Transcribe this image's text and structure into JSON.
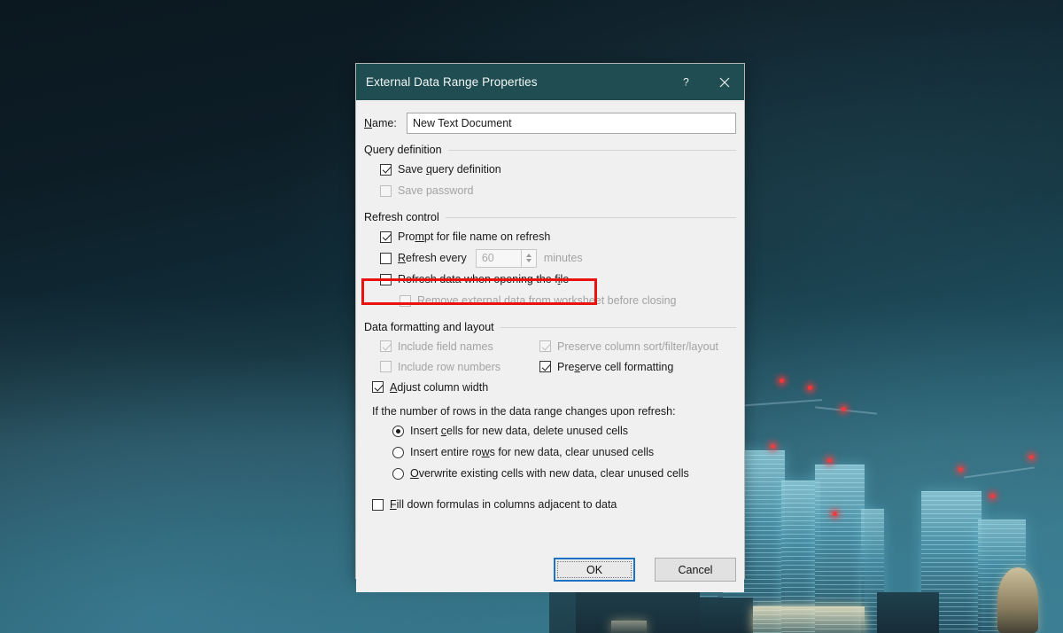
{
  "desktop": {
    "wallpaper_name": "london-night-skyline"
  },
  "dialog": {
    "title": "External Data Range Properties",
    "help_icon": "question-mark-icon",
    "close_icon": "close-icon",
    "name_label": "Name:",
    "name_value": "New Text Document",
    "groups": [
      {
        "id": "query-definition",
        "header": "Query definition",
        "items": [
          {
            "id": "save-query-definition",
            "type": "checkbox",
            "label": "Save query definition",
            "checked": true,
            "disabled": false,
            "indent": 1
          },
          {
            "id": "save-password",
            "type": "checkbox",
            "label": "Save password",
            "checked": false,
            "disabled": true,
            "indent": 1
          }
        ]
      },
      {
        "id": "refresh-control",
        "header": "Refresh control",
        "items": [
          {
            "id": "prompt-for-file-name-on-refresh",
            "type": "checkbox",
            "label": "Prompt for file name on refresh",
            "checked": true,
            "disabled": false,
            "indent": 1,
            "highlighted": true
          },
          {
            "id": "refresh-every",
            "type": "checkbox",
            "label": "Refresh every",
            "checked": false,
            "disabled": false,
            "indent": 1,
            "spinner": {
              "value": "60",
              "disabled": true,
              "unit_label": "minutes"
            }
          },
          {
            "id": "refresh-data-when-opening-the-file",
            "type": "checkbox",
            "label": "Refresh data when opening the file",
            "checked": false,
            "disabled": false,
            "indent": 1
          },
          {
            "id": "remove-external-data-before-closing",
            "type": "checkbox",
            "label": "Remove external data from worksheet before closing",
            "checked": false,
            "disabled": true,
            "indent": 2
          }
        ]
      },
      {
        "id": "data-formatting-and-layout",
        "header": "Data formatting and layout",
        "items": [
          {
            "id": "include-field-names",
            "type": "checkbox",
            "label": "Include field names",
            "checked": true,
            "disabled": true,
            "column": "a"
          },
          {
            "id": "preserve-column-sort-filter-layout",
            "type": "checkbox",
            "label": "Preserve column sort/filter/layout",
            "checked": true,
            "disabled": true,
            "column": "b"
          },
          {
            "id": "include-row-numbers",
            "type": "checkbox",
            "label": "Include row numbers",
            "checked": false,
            "disabled": true,
            "column": "a"
          },
          {
            "id": "preserve-cell-formatting",
            "type": "checkbox",
            "label": "Preserve cell formatting",
            "checked": true,
            "disabled": false,
            "column": "b"
          },
          {
            "id": "adjust-column-width",
            "type": "checkbox",
            "label": "Adjust column width",
            "checked": true,
            "disabled": false,
            "column": "a"
          }
        ],
        "note": "If the number of rows in the data range changes upon refresh:",
        "radios": [
          {
            "id": "insert-cells-for-new-data",
            "label": "Insert cells for new data, delete unused cells",
            "selected": true
          },
          {
            "id": "insert-entire-rows-for-new-data",
            "label": "Insert entire rows for new data, clear unused cells",
            "selected": false
          },
          {
            "id": "overwrite-existing-cells",
            "label": "Overwrite existing cells with new data, clear unused cells",
            "selected": false
          }
        ],
        "trailing": [
          {
            "id": "fill-down-formulas",
            "type": "checkbox",
            "label": "Fill down formulas in columns adjacent to data",
            "checked": false,
            "disabled": false
          }
        ]
      }
    ],
    "buttons": {
      "ok": "OK",
      "cancel": "Cancel"
    }
  },
  "annotation": {
    "highlight_color": "#e8130f",
    "target": "prompt-for-file-name-on-refresh"
  },
  "theme": {
    "titlebar_bg": "#1f4d52",
    "dialog_bg": "#f0f0f0",
    "accent_focus": "#1c72c4",
    "disabled_text": "#a3a3a3"
  }
}
